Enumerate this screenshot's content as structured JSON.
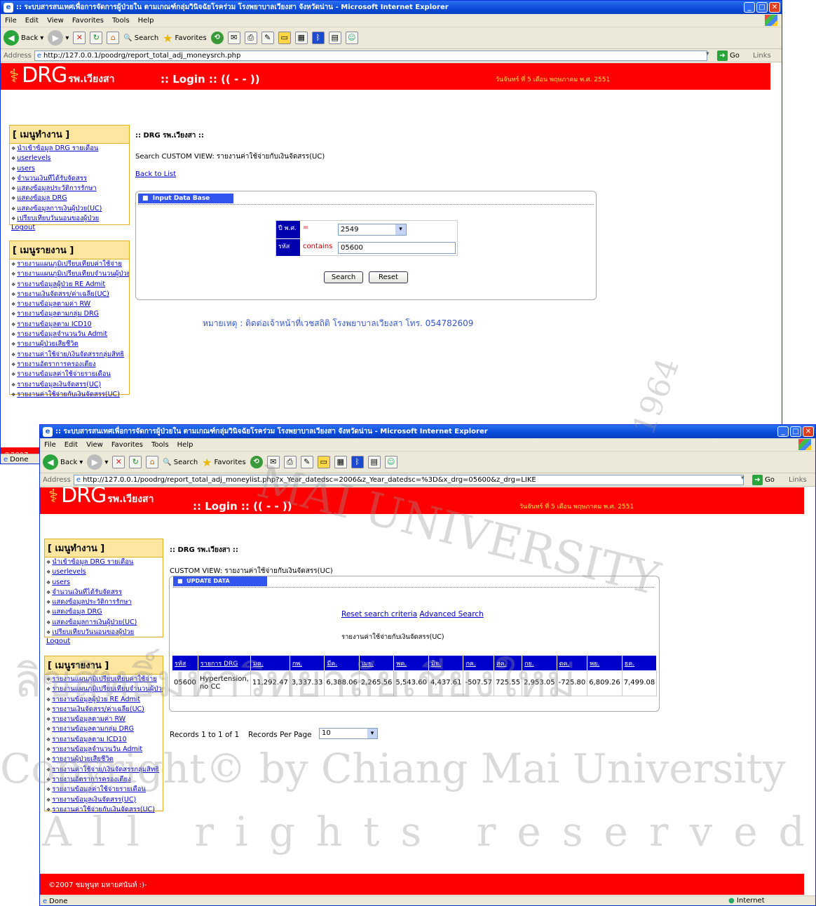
{
  "win1": {
    "title": ":: ระบบสารสนเทศเพื่อการจัดการผู้ป่วยใน ตามเกณฑ์กลุ่มวินิจฉัยโรคร่วม โรงพยาบาลเวียงสา จังหวัดน่าน - Microsoft Internet Explorer",
    "menu": [
      "File",
      "Edit",
      "View",
      "Favorites",
      "Tools",
      "Help"
    ],
    "back": "Back",
    "search": "Search",
    "favorites": "Favorites",
    "address_label": "Address",
    "url": "http://127.0.0.1/poodrg/report_total_adj_moneysrch.php",
    "go": "Go",
    "links": "Links",
    "login": ":: Login :: (( - - ))",
    "date": "วันจันทร์ ที่ 5 เดือน พฤษภาคม พ.ศ. 2551",
    "heading": ":: DRG รพ.เวียงสา ::",
    "custom_view": "Search CUSTOM VIEW: รายงานค่าใช้จ่ายกับเงินจัดสรร(UC)",
    "back_to_list": "Back to List",
    "panel_title": "Input Data Base",
    "f1_label": "ปี พ.ศ.",
    "f1_op": "=",
    "f1_value": "2549",
    "f2_label": "รหัส",
    "f2_op": "contains",
    "f2_value": "05600",
    "search_btn": "Search",
    "reset_btn": "Reset",
    "note": "หมายเหตุ : ติดต่อเจ้าหน้าที่เวชสถิติ โรงพยาบาลเวียงสา โทร. 054782609",
    "footer_partial": "©2007",
    "status": "Done"
  },
  "win2": {
    "title": ":: ระบบสารสนเทศเพื่อการจัดการผู้ป่วยใน ตามเกณฑ์กลุ่มวินิจฉัยโรคร่วม โรงพยาบาลเวียงสา จังหวัดน่าน - Microsoft Internet Explorer",
    "url": "http://127.0.0.1/poodrg/report_total_adj_moneylist.php?x_Year_datedsc=2006&z_Year_datedsc=%3D&x_drg=05600&z_drg=LIKE",
    "login": ":: Login :: (( - - ))",
    "date": "วันจันทร์ ที่ 5 เดือน พฤษภาคม พ.ศ. 2551",
    "heading": ":: DRG รพ.เวียงสา ::",
    "custom_view": "CUSTOM VIEW: รายงานค่าใช้จ่ายกับเงินจัดสรร(UC)",
    "panel_title": "UPDATE DATA",
    "reset_search": "Reset search criteria",
    "advanced_search": "Advanced Search",
    "report_title": "รายงานค่าใช้จ่ายกับเงินจัดสรร(UC)",
    "columns": [
      "รหัส",
      "รายการ DRG",
      "มค.",
      "กพ.",
      "มีค.",
      "เมย.",
      "พค.",
      "มิย.",
      "กค.",
      "สค.",
      "กย.",
      "ตค.",
      "พย.",
      "ธค."
    ],
    "row": [
      "05600",
      "Hypertension, no CC",
      "11,292.47",
      "3,337.33",
      "6,388.06",
      "2,265.56",
      "5,543.60",
      "4,437.61",
      "-507.57",
      "725.55",
      "2,953.05",
      "-725.80",
      "6,809.26",
      "7,499.08"
    ],
    "records": "Records 1 to 1 of 1",
    "per_page_label": "Records Per Page",
    "per_page": "10",
    "footer": "©2007 ชมพูนุท มหายศนันท์ :)-",
    "status": "Done",
    "zone": "Internet"
  },
  "menu_work": {
    "title": "[ เมนูทำงาน ]",
    "items": [
      "นำเข้าข้อมูล DRG รายเดือน",
      "userlevels",
      "users",
      "จำนวนเงินที่ได้รับจัดสรร",
      "แสดงข้อมูลประวัติการรักษา",
      "แสดงข้อมูล DRG",
      "แสดงข้อมูลการเงินผู้ป่วย(UC)",
      "เปรียบเทียบวันนอนของผู้ป่วย"
    ],
    "logout": "Logout"
  },
  "menu_report": {
    "title": "[ เมนูรายงาน ]",
    "items": [
      "รายงานแผนภูมิเปรียบเทียบค่าใช้จ่าย",
      "รายงานแผนภูมิเปรียบเทียบจำนวนผู้ป่วย",
      "รายงานข้อมูลผู้ป่วย RE Admit",
      "รายงานเงินจัดสรร/ค่าเฉลี่ย(UC)",
      "รายงานข้อมูลตามค่า RW",
      "รายงานข้อมูลตามกลุ่ม DRG",
      "รายงานข้อมูลตาม ICD10",
      "รายงานข้อมูลจำนวนวัน Admit",
      "รายงานผู้ป่วยเสียชีวิต",
      "รายงานค่าใช้จ่าย/เงินจัดสรรกลุ่มสิทธิ",
      "รายงานอัตราการครองเตียง",
      "รายงานข้อมูลค่าใช้จ่ายรายเดือน",
      "รายงานข้อมูลเงินจัดสรร(UC)",
      "รายงานค่าใช้จ่ายกับเงินจัดสรร(UC)"
    ]
  },
  "brand": {
    "drg": "DRG",
    "hosp": "รพ.เวียงสา"
  },
  "watermark": {
    "line1": "ลิขสิทธิ์มหาวิทยาลัยเชียงใหม่",
    "line2": "Copyright© by Chiang Mai University",
    "line3": "All rights reserved",
    "seal": "MAI UNIVERSITY",
    "year": "1964"
  }
}
